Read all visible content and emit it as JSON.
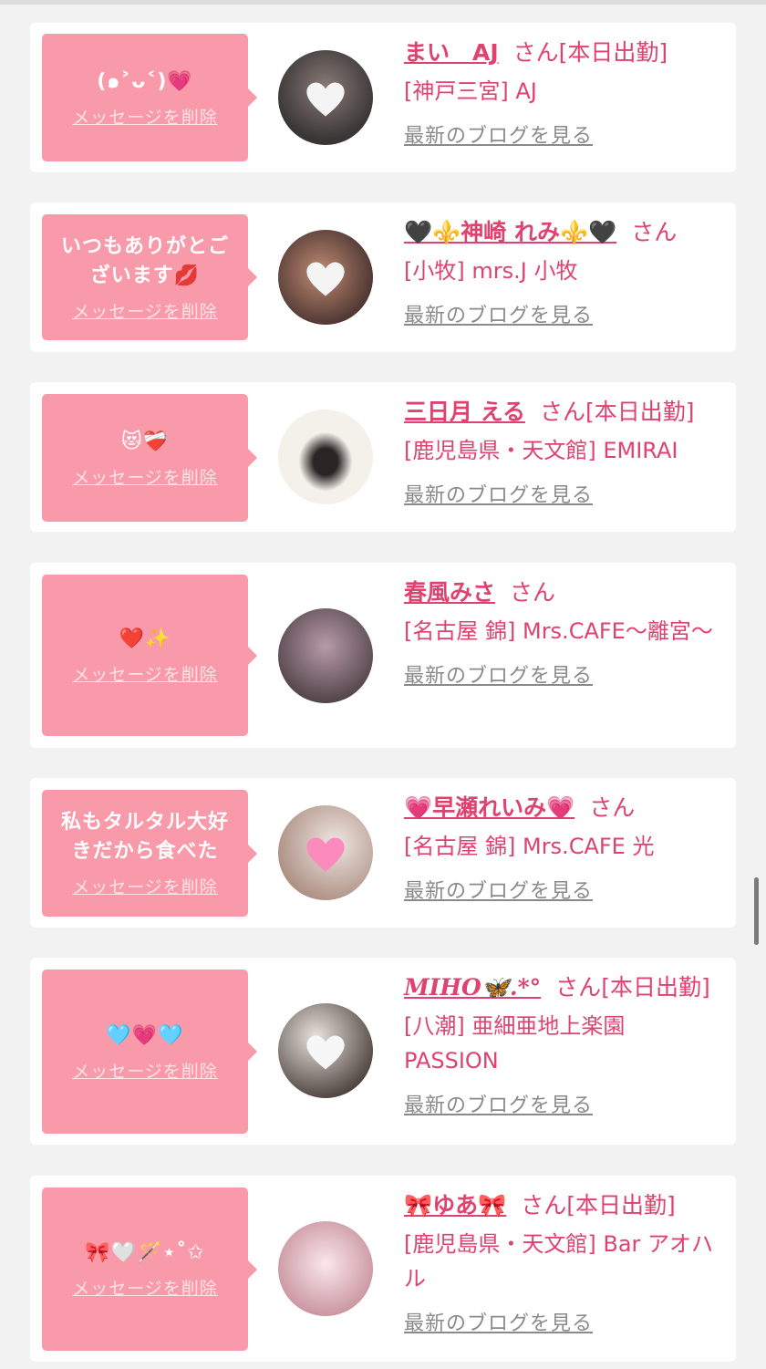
{
  "delete_label": "メッセージを削除",
  "blog_label": "最新のブログを見る",
  "san_label": "さん",
  "messages": [
    {
      "message": "(๑˃ᴗ˂)💗",
      "name": "まい　AJ",
      "status": "[本日出勤]",
      "shop": "[神戸三宮] AJ",
      "avatar_colors": [
        "#3a3636",
        "#8a7b78"
      ]
    },
    {
      "message": "いつもありがとございます💋",
      "name": "🖤⚜️神崎 れみ⚜️🖤",
      "status": "",
      "shop": "[小牧] mrs.J 小牧",
      "avatar_colors": [
        "#c08b74",
        "#4a3330"
      ]
    },
    {
      "message": "😻❤️‍🩹",
      "name": "三日月 える",
      "status": "[本日出勤]",
      "shop": "[鹿児島県・天文館] EMIRAI",
      "avatar_colors": [
        "#f4f0ea",
        "#2b2424"
      ]
    },
    {
      "message": "❤️✨",
      "name": "春風みさ",
      "status": "",
      "shop": "[名古屋 錦] Mrs.CAFE～離宮～",
      "avatar_colors": [
        "#b79aa8",
        "#4d4044"
      ]
    },
    {
      "message": "私もタルタル大好きだから食べた",
      "name": "💗早瀬れいみ💗",
      "status": "",
      "shop": "[名古屋 錦] Mrs.CAFE 光",
      "avatar_colors": [
        "#efe5e2",
        "#a88a7c"
      ]
    },
    {
      "message": "🩵💗🩵",
      "name": "MIHO🦋.*°",
      "status": "[本日出勤]",
      "shop": "[八潮] 亜細亜地上楽園 PASSION",
      "avatar_colors": [
        "#e8e2dc",
        "#3b302c"
      ]
    },
    {
      "message": "🎀🤍🪄⋆˚✩",
      "name": "🎀ゆあ🎀",
      "status": "[本日出勤]",
      "shop": "[鹿児島県・天文館] Bar アオハル",
      "avatar_colors": [
        "#fbe6ec",
        "#c28a94"
      ]
    }
  ],
  "colors": {
    "accent": "#e0426f",
    "bubble": "#f99aab",
    "background": "#f2f2f2",
    "link_gray": "#8a8a8a"
  }
}
